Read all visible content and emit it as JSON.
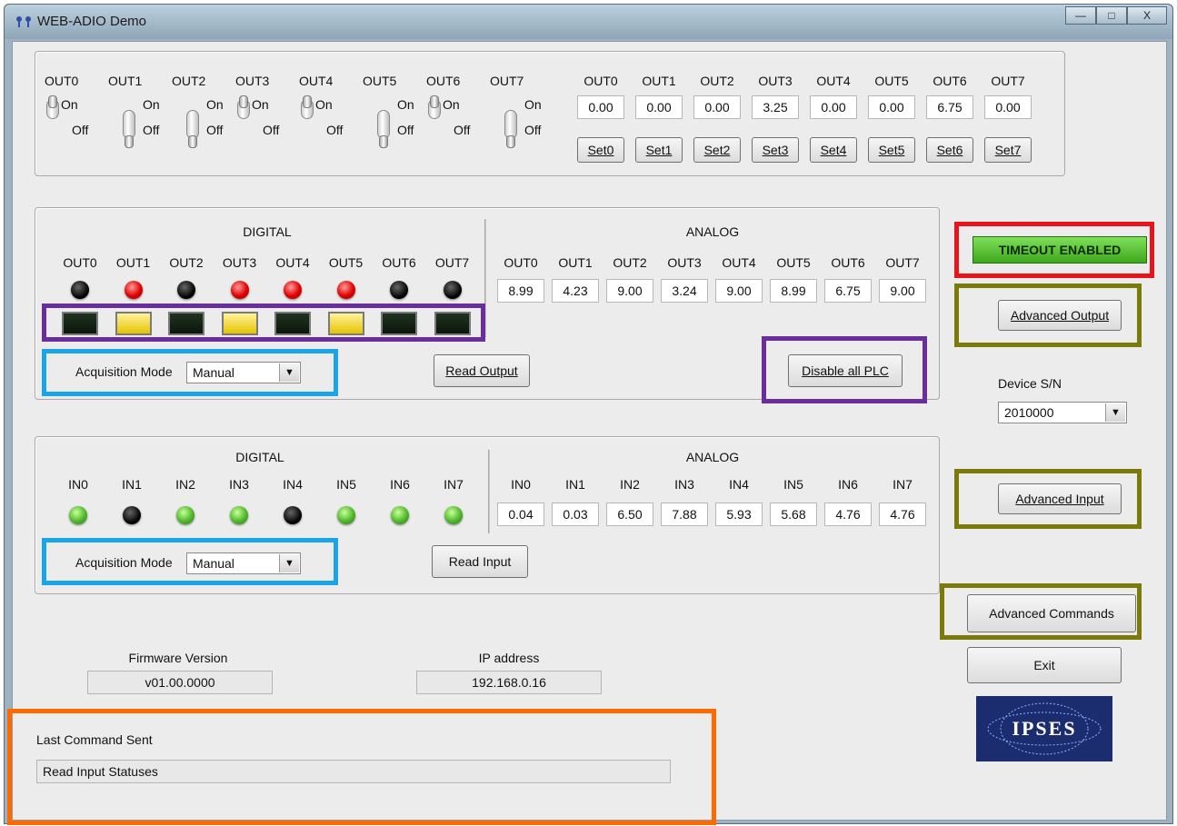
{
  "window": {
    "title": "WEB-ADIO Demo",
    "minimize_glyph": "—",
    "maximize_glyph": "□",
    "close_glyph": "X"
  },
  "output_controls": {
    "digital": [
      {
        "label": "OUT0",
        "state": "On"
      },
      {
        "label": "OUT1",
        "state": "Off"
      },
      {
        "label": "OUT2",
        "state": "Off"
      },
      {
        "label": "OUT3",
        "state": "On"
      },
      {
        "label": "OUT4",
        "state": "On"
      },
      {
        "label": "OUT5",
        "state": "Off"
      },
      {
        "label": "OUT6",
        "state": "On"
      },
      {
        "label": "OUT7",
        "state": "Off"
      }
    ],
    "on_label": "On",
    "off_label": "Off",
    "analog": [
      {
        "label": "OUT0",
        "value": "0.00",
        "button": "Set0"
      },
      {
        "label": "OUT1",
        "value": "0.00",
        "button": "Set1"
      },
      {
        "label": "OUT2",
        "value": "0.00",
        "button": "Set2"
      },
      {
        "label": "OUT3",
        "value": "3.25",
        "button": "Set3"
      },
      {
        "label": "OUT4",
        "value": "0.00",
        "button": "Set4"
      },
      {
        "label": "OUT5",
        "value": "0.00",
        "button": "Set5"
      },
      {
        "label": "OUT6",
        "value": "6.75",
        "button": "Set6"
      },
      {
        "label": "OUT7",
        "value": "0.00",
        "button": "Set7"
      }
    ]
  },
  "output_readback": {
    "digital_title": "DIGITAL",
    "analog_title": "ANALOG",
    "digital": [
      {
        "label": "OUT0",
        "led": "black",
        "square": "dark"
      },
      {
        "label": "OUT1",
        "led": "red",
        "square": "yellow"
      },
      {
        "label": "OUT2",
        "led": "black",
        "square": "dark"
      },
      {
        "label": "OUT3",
        "led": "red",
        "square": "yellow"
      },
      {
        "label": "OUT4",
        "led": "red",
        "square": "dark"
      },
      {
        "label": "OUT5",
        "led": "red",
        "square": "yellow"
      },
      {
        "label": "OUT6",
        "led": "black",
        "square": "dark"
      },
      {
        "label": "OUT7",
        "led": "black",
        "square": "dark"
      }
    ],
    "analog": [
      {
        "label": "OUT0",
        "value": "8.99"
      },
      {
        "label": "OUT1",
        "value": "4.23"
      },
      {
        "label": "OUT2",
        "value": "9.00"
      },
      {
        "label": "OUT3",
        "value": "3.24"
      },
      {
        "label": "OUT4",
        "value": "9.00"
      },
      {
        "label": "OUT5",
        "value": "8.99"
      },
      {
        "label": "OUT6",
        "value": "6.75"
      },
      {
        "label": "OUT7",
        "value": "9.00"
      }
    ],
    "acq_label": "Acquisition Mode",
    "acq_value": "Manual",
    "read_button": "Read Output",
    "disable_button": "Disable all PLC"
  },
  "input_readback": {
    "digital_title": "DIGITAL",
    "analog_title": "ANALOG",
    "digital": [
      {
        "label": "IN0",
        "led": "green"
      },
      {
        "label": "IN1",
        "led": "black"
      },
      {
        "label": "IN2",
        "led": "green"
      },
      {
        "label": "IN3",
        "led": "green"
      },
      {
        "label": "IN4",
        "led": "black"
      },
      {
        "label": "IN5",
        "led": "green"
      },
      {
        "label": "IN6",
        "led": "green"
      },
      {
        "label": "IN7",
        "led": "green"
      }
    ],
    "analog": [
      {
        "label": "IN0",
        "value": "0.04"
      },
      {
        "label": "IN1",
        "value": "0.03"
      },
      {
        "label": "IN2",
        "value": "6.50"
      },
      {
        "label": "IN3",
        "value": "7.88"
      },
      {
        "label": "IN4",
        "value": "5.93"
      },
      {
        "label": "IN5",
        "value": "5.68"
      },
      {
        "label": "IN6",
        "value": "4.76"
      },
      {
        "label": "IN7",
        "value": "4.76"
      }
    ],
    "acq_label": "Acquisition Mode",
    "acq_value": "Manual",
    "read_button": "Read Input"
  },
  "side": {
    "timeout": "TIMEOUT ENABLED",
    "advanced_output": "Advanced Output",
    "device_sn_label": "Device S/N",
    "device_sn_value": "2010000",
    "advanced_input": "Advanced Input",
    "advanced_commands": "Advanced Commands",
    "exit": "Exit",
    "logo_text": "IPSES"
  },
  "info": {
    "firmware_label": "Firmware Version",
    "firmware_value": "v01.00.0000",
    "ip_label": "IP address",
    "ip_value": "192.168.0.16",
    "last_cmd_label": "Last Command Sent",
    "last_cmd_value": "Read Input Statuses"
  },
  "colors": {
    "highlight_red": "#e8131b",
    "highlight_purple": "#6a2d9c",
    "highlight_blue": "#1aa6e6",
    "highlight_olive": "#7b7b0b",
    "highlight_orange": "#ff6a00",
    "led_green": "#4fb82a",
    "led_red": "#e00000"
  }
}
